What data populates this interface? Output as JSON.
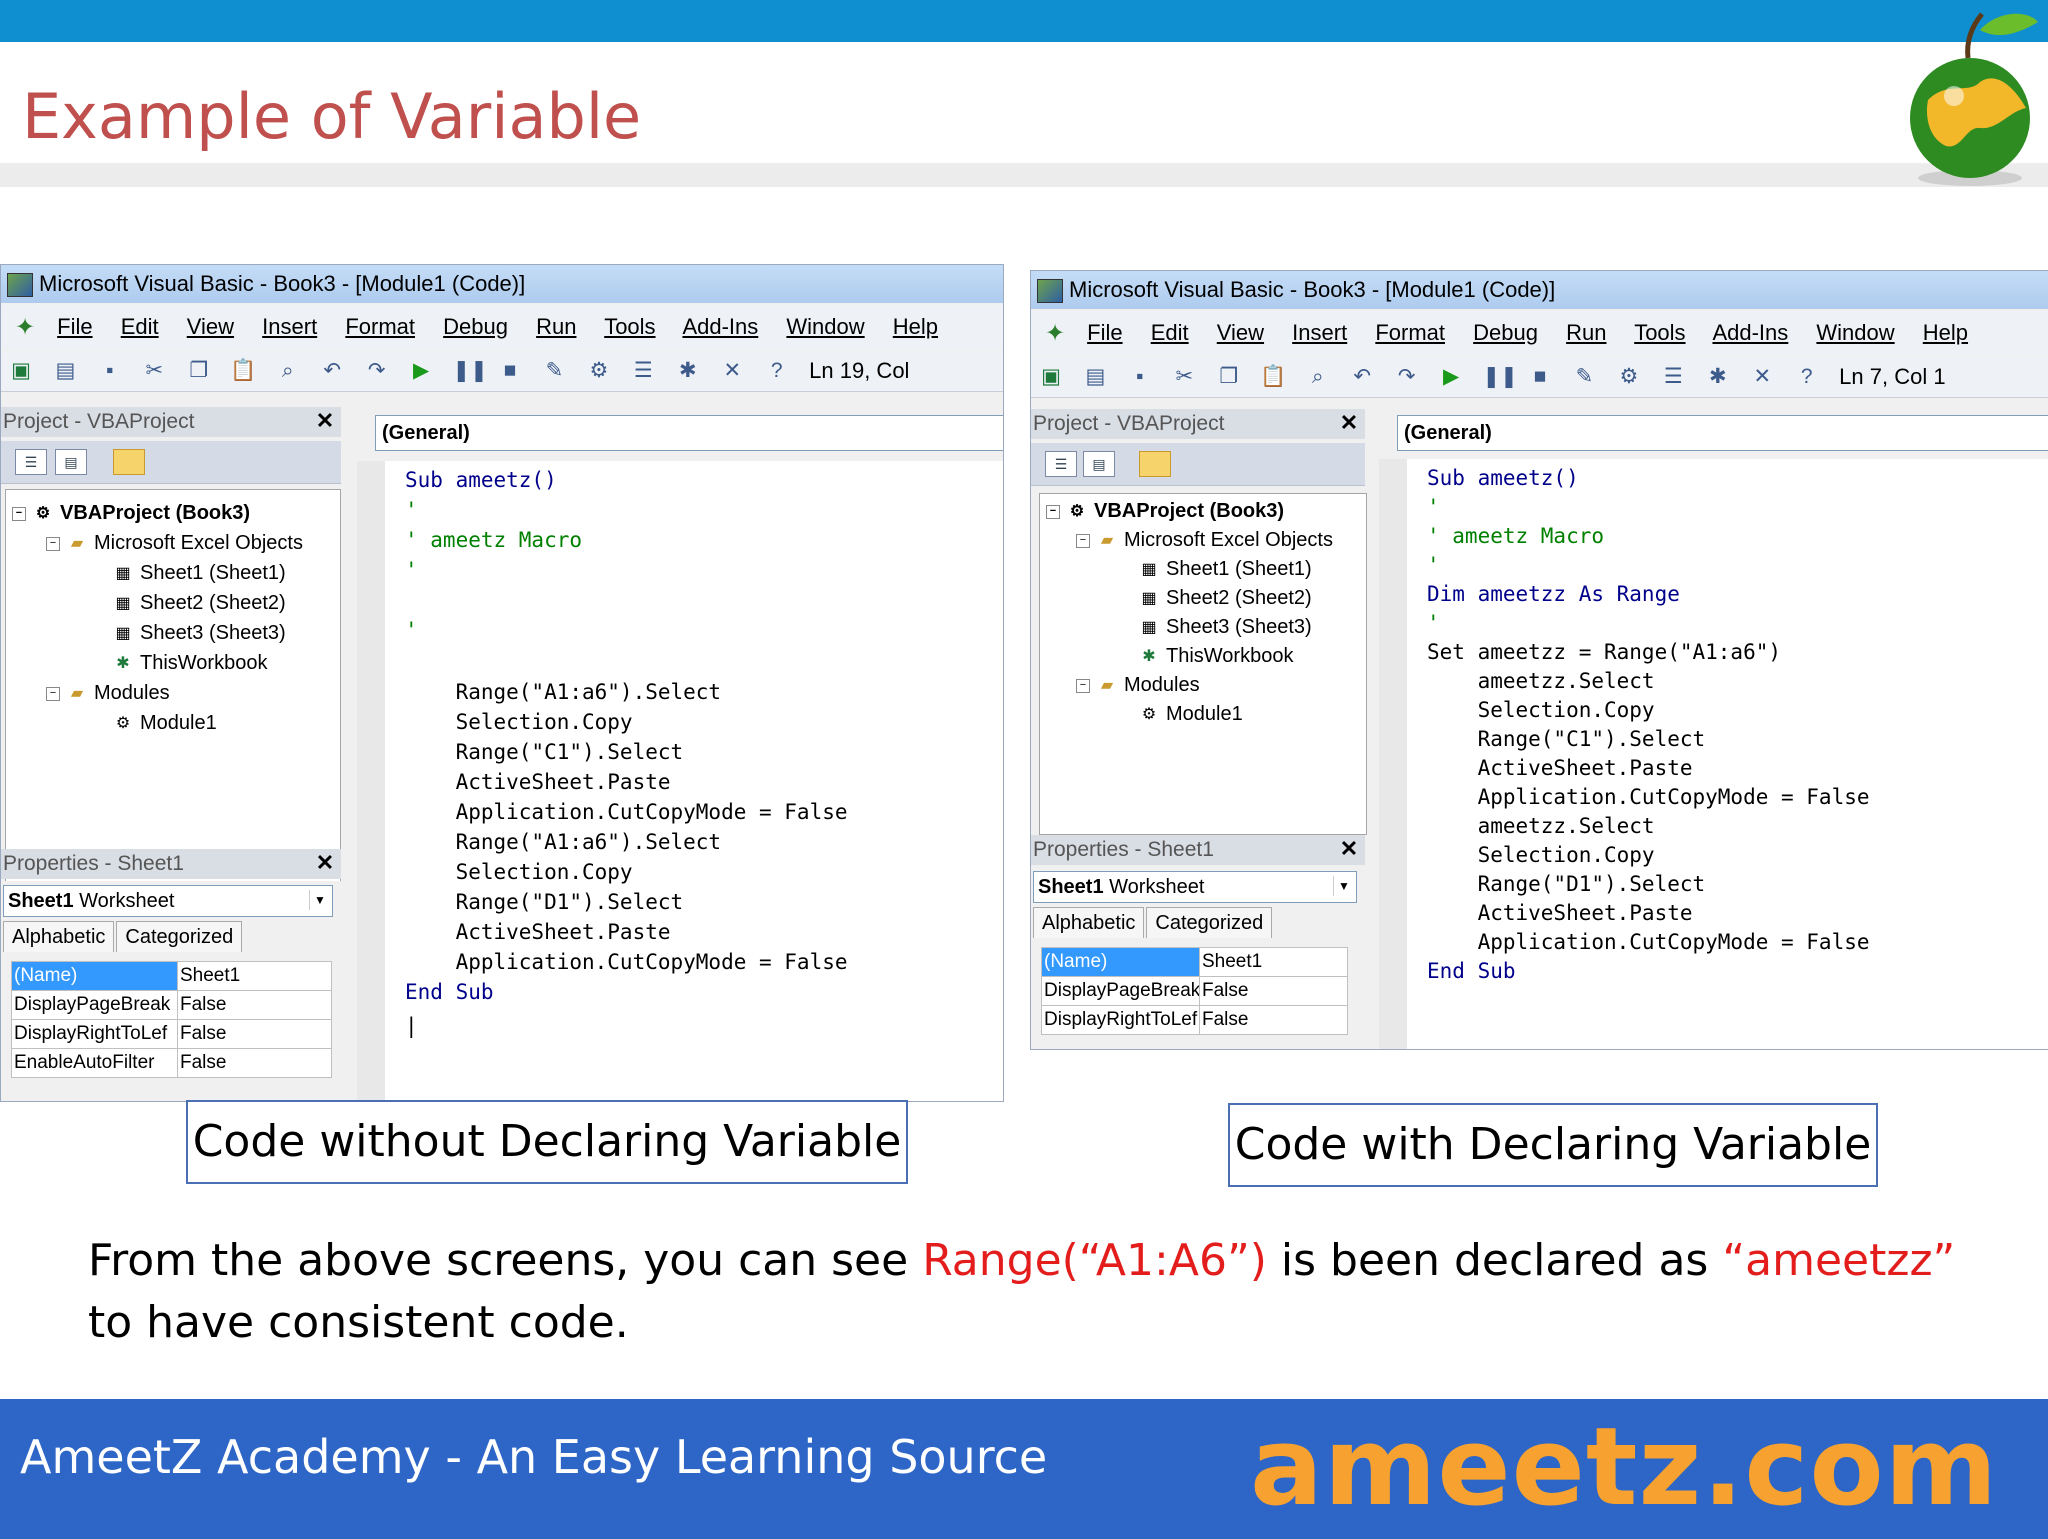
{
  "slide": {
    "title": "Example of Variable",
    "explanation": {
      "p1": "From the above screens, you can see ",
      "highlight1": "Range(“A1:A6”)",
      "p2": " is been declared as ",
      "highlight2": "“ameetzz”",
      "p3": " to have consistent code."
    },
    "footer": "AmeetZ Academy - An Easy Learning Source",
    "brand": "ameetz.com",
    "colors": {
      "title": "#c0504d",
      "topbar": "#0f8fd0",
      "footer": "#2d66c6",
      "brand": "#f7a130",
      "highlight": "#e31c1c"
    }
  },
  "left_window": {
    "title": "Microsoft Visual Basic - Book3 - [Module1 (Code)]",
    "menu": [
      "File",
      "Edit",
      "View",
      "Insert",
      "Format",
      "Debug",
      "Run",
      "Tools",
      "Add-Ins",
      "Window",
      "Help"
    ],
    "position": "Ln 19, Col",
    "project_header": "Project - VBAProject",
    "tree": {
      "root": "VBAProject (Book3)",
      "objects_folder": "Microsoft Excel Objects",
      "sheet1": "Sheet1 (Sheet1)",
      "sheet2": "Sheet2 (Sheet2)",
      "sheet3": "Sheet3 (Sheet3)",
      "workbook": "ThisWorkbook",
      "modules_folder": "Modules",
      "module": "Module1"
    },
    "properties_header": "Properties - Sheet1",
    "properties_combo": {
      "name": "Sheet1",
      "type": "Worksheet"
    },
    "tabs": [
      "Alphabetic",
      "Categorized"
    ],
    "properties": [
      [
        "(Name)",
        "Sheet1"
      ],
      [
        "DisplayPageBreak",
        "False"
      ],
      [
        "DisplayRightToLef",
        "False"
      ],
      [
        "EnableAutoFilter",
        "False"
      ]
    ],
    "general_combo": "(General)",
    "code_lines": [
      "Sub ameetz()",
      "'",
      "' ameetz Macro",
      "'",
      "",
      "'",
      "",
      "    Range(\"A1:a6\").Select",
      "    Selection.Copy",
      "    Range(\"C1\").Select",
      "    ActiveSheet.Paste",
      "    Application.CutCopyMode = False",
      "    Range(\"A1:a6\").Select",
      "    Selection.Copy",
      "    Range(\"D1\").Select",
      "    ActiveSheet.Paste",
      "    Application.CutCopyMode = False",
      "End Sub"
    ],
    "caption": "Code without Declaring Variable"
  },
  "right_window": {
    "title": "Microsoft Visual Basic - Book3 - [Module1 (Code)]",
    "menu": [
      "File",
      "Edit",
      "View",
      "Insert",
      "Format",
      "Debug",
      "Run",
      "Tools",
      "Add-Ins",
      "Window",
      "Help"
    ],
    "position": "Ln 7, Col 1",
    "project_header": "Project - VBAProject",
    "tree": {
      "root": "VBAProject (Book3)",
      "objects_folder": "Microsoft Excel Objects",
      "sheet1": "Sheet1 (Sheet1)",
      "sheet2": "Sheet2 (Sheet2)",
      "sheet3": "Sheet3 (Sheet3)",
      "workbook": "ThisWorkbook",
      "modules_folder": "Modules",
      "module": "Module1"
    },
    "properties_header": "Properties - Sheet1",
    "properties_combo": {
      "name": "Sheet1",
      "type": "Worksheet"
    },
    "tabs": [
      "Alphabetic",
      "Categorized"
    ],
    "properties": [
      [
        "(Name)",
        "Sheet1"
      ],
      [
        "DisplayPageBreak",
        "False"
      ],
      [
        "DisplayRightToLef",
        "False"
      ]
    ],
    "general_combo": "(General)",
    "code_lines": [
      "Sub ameetz()",
      "'",
      "' ameetz Macro",
      "'",
      "Dim ameetzz As Range",
      "'",
      "Set ameetzz = Range(\"A1:a6\")",
      "    ameetzz.Select",
      "    Selection.Copy",
      "    Range(\"C1\").Select",
      "    ActiveSheet.Paste",
      "    Application.CutCopyMode = False",
      "    ameetzz.Select",
      "    Selection.Copy",
      "    Range(\"D1\").Select",
      "    ActiveSheet.Paste",
      "    Application.CutCopyMode = False",
      "End Sub"
    ],
    "caption": "Code with Declaring Variable"
  }
}
